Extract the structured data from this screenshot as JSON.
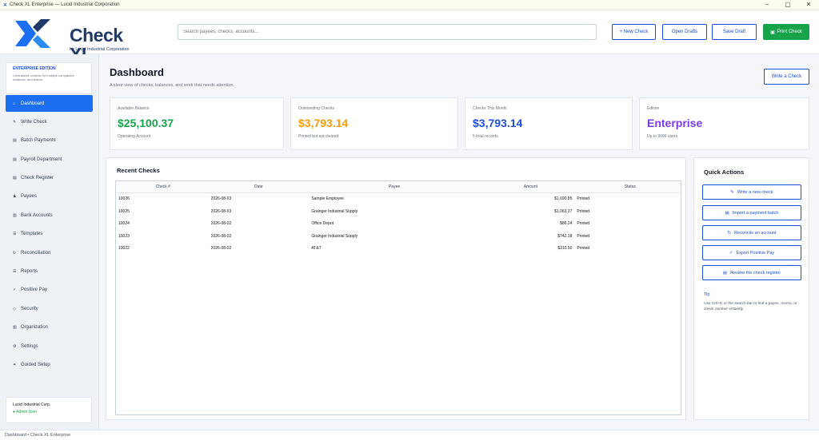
{
  "window": {
    "title": "Check XL Enterprise — Lucid Industrial Corporation",
    "minimize": "–",
    "maximize": "▢",
    "close": "✕"
  },
  "brand": {
    "name": "Check XL",
    "tagline": "by Lucid Industrial Corporation",
    "colors": {
      "primary": "#1f3a68",
      "accent": "#1d6ff2"
    }
  },
  "search": {
    "placeholder": "Search payees, checks, accounts..."
  },
  "header_buttons": {
    "new_check": "+ New Check",
    "open_drafts": "Open Drafts",
    "save_draft": "Save Draft",
    "print_check": "Print Check",
    "print_icon": "printer-icon"
  },
  "sidebar": {
    "edition_title": "ENTERPRISE EDITION",
    "edition_desc": "Centralized controls for multiple companies, locations, and teams.",
    "items": [
      {
        "label": "Dashboard",
        "icon": "⌂",
        "active": true
      },
      {
        "label": "Write Check",
        "icon": "✎"
      },
      {
        "label": "Batch Payments",
        "icon": "▤"
      },
      {
        "label": "Payroll Department",
        "icon": "▤"
      },
      {
        "label": "Check Register",
        "icon": "▤"
      },
      {
        "label": "Payees",
        "icon": "♟"
      },
      {
        "label": "Bank Accounts",
        "icon": "▥"
      },
      {
        "label": "Templates",
        "icon": "☰"
      },
      {
        "label": "Reconciliation",
        "icon": "↻"
      },
      {
        "label": "Reports",
        "icon": "☰"
      },
      {
        "label": "Positive Pay",
        "icon": "✓"
      },
      {
        "label": "Security",
        "icon": "◇"
      },
      {
        "label": "Organization",
        "icon": "▥"
      },
      {
        "label": "Settings",
        "icon": "⚙"
      },
      {
        "label": "Guided Setup",
        "icon": "✦"
      }
    ],
    "org_name": "Lucid Industrial Corp.",
    "user": "● Admin User"
  },
  "dashboard": {
    "title": "Dashboard",
    "subtitle": "A clear view of checks, balances, and work that needs attention.",
    "write_check": "Write a Check",
    "cards": [
      {
        "label": "Available Balance",
        "value": "$25,100.37",
        "sub": "Operating Account",
        "color": "#16a34a"
      },
      {
        "label": "Outstanding Checks",
        "value": "$3,793.14",
        "sub": "Printed but not cleared",
        "color": "#f59e0b"
      },
      {
        "label": "Checks This Month",
        "value": "$3,793.14",
        "sub": "5 total records",
        "color": "#1d4ed8"
      },
      {
        "label": "Edition",
        "value": "Enterprise",
        "sub": "Up to 9999 users",
        "color": "#7c3aed"
      }
    ]
  },
  "recent": {
    "title": "Recent Checks",
    "columns": [
      "Check #",
      "Date",
      "Payee",
      "Amount",
      "Status"
    ],
    "rows": [
      [
        "10026",
        "2026-08-03",
        "Sample Employee",
        "$1,690.85",
        "Printed"
      ],
      [
        "10025",
        "2026-08-03",
        "Grainger Industrial Supply",
        "$1,063.37",
        "Printed"
      ],
      [
        "10024",
        "2026-08-02",
        "Office Depot",
        "$86.24",
        "Printed"
      ],
      [
        "10023",
        "2026-08-02",
        "Grainger Industrial Supply",
        "$742.18",
        "Printed"
      ],
      [
        "10022",
        "2026-08-02",
        "AT&T",
        "$210.50",
        "Printed"
      ]
    ]
  },
  "quick_actions": {
    "title": "Quick Actions",
    "items": [
      {
        "label": "Write a new check",
        "icon": "✎"
      },
      {
        "label": "Import a payment batch",
        "icon": "▤"
      },
      {
        "label": "Reconcile an account",
        "icon": "↻"
      },
      {
        "label": "Export Positive Pay",
        "icon": "✓"
      },
      {
        "label": "Review the check register",
        "icon": "▤"
      }
    ],
    "tip_title": "Tip",
    "tip_text": "Use Ctrl+K or the search bar to find a payee, memo, or check number instantly."
  },
  "statusbar": {
    "text": "Dashboard • Check XL Enterprise"
  }
}
